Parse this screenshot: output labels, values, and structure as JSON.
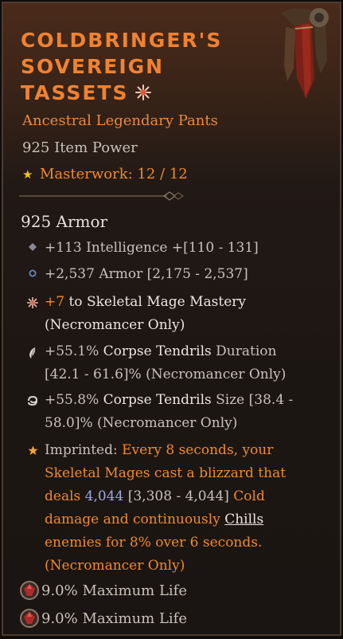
{
  "item": {
    "name_lines": [
      "COLDBRINGER'S",
      "SOVEREIGN",
      "TASSETS"
    ],
    "subtitle": "Ancestral Legendary Pants",
    "item_power": "925 Item Power",
    "masterwork": "Masterwork: 12 / 12",
    "armor": "925 Armor"
  },
  "stats": [
    {
      "text": "+113 Intelligence +[110 - 131]",
      "icon": "diamond-icon"
    },
    {
      "text": "+2,537 Armor [2,175 - 2,537]",
      "icon": "circle-icon"
    }
  ],
  "aspects": {
    "mastery": {
      "value": "+7",
      "rest": "to Skeletal Mage Mastery",
      "line2": "(Necromancer Only)",
      "icon": "starburst-icon"
    },
    "duration": {
      "value": "+55.1%",
      "skill": "Corpse Tendrils",
      "rest": "Duration",
      "line2": "[42.1 - 61.6]% (Necromancer Only)",
      "icon": "feather-icon"
    },
    "size": {
      "value": "+55.8%",
      "skill": "Corpse Tendrils",
      "rest": "Size [38.4 -",
      "line2": "58.0]% (Necromancer Only)",
      "icon": "swirl-icon"
    }
  },
  "imprint": {
    "label": "Imprinted:",
    "line1": "Every 8 seconds, your",
    "line2": "Skeletal Mages cast a blizzard that",
    "line3_pre": "deals",
    "line3_value": "4,044",
    "line3_range": "[3,308 - 4,044]",
    "line3_post": "Cold",
    "line4_pre": "damage and continuously",
    "line4_link": "Chills",
    "line5": "enemies for 8% over 6 seconds.",
    "line6": "(Necromancer Only)"
  },
  "socket_stats": [
    "9.0% Maximum Life",
    "9.0% Maximum Life"
  ],
  "colors": {
    "legendary_orange": "#f08232",
    "stat_gray": "#c8c2ba",
    "value_blue": "#a2a8e6",
    "star_gold": "#f2c037"
  }
}
